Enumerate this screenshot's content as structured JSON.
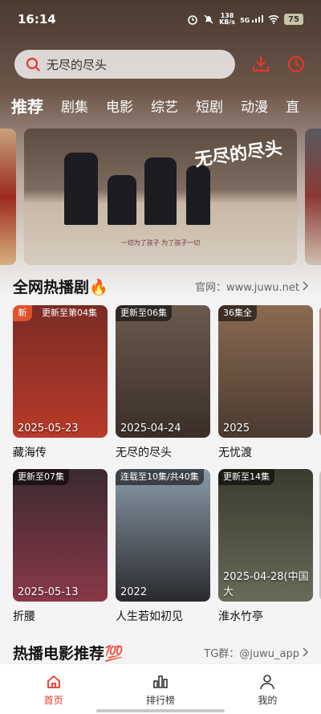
{
  "status_bar": {
    "time": "16:14",
    "net_speed_value": "138",
    "net_speed_unit": "KB/s",
    "signal_label": "5G",
    "battery": "75"
  },
  "search": {
    "value": "无尽的尽头"
  },
  "tabs": [
    {
      "label": "推荐",
      "active": true
    },
    {
      "label": "剧集"
    },
    {
      "label": "电影"
    },
    {
      "label": "综艺"
    },
    {
      "label": "短剧"
    },
    {
      "label": "动漫"
    },
    {
      "label": "直"
    }
  ],
  "banner": {
    "title": "无尽的尽头",
    "tagline": "一切为了孩子  为了孩子一切"
  },
  "hot_section": {
    "title": "全网热播剧",
    "emoji": "🔥",
    "link_text": "官网：www.juwu.net"
  },
  "hot_row1": [
    {
      "badge_new": "新",
      "badge": "更新至第04集",
      "date": "2025-05-23",
      "title": "藏海传",
      "color_top": "#7a2c24",
      "color_bottom": "#b83a2a"
    },
    {
      "badge": "更新至06集",
      "date": "2025-04-24",
      "title": "无尽的尽头",
      "color_top": "#6a5a4e",
      "color_bottom": "#3a2e28"
    },
    {
      "badge": "36集全",
      "date": "2025",
      "title": "无忧渡",
      "color_top": "#8a6a52",
      "color_bottom": "#4a3a30"
    }
  ],
  "hot_row2": [
    {
      "badge": "更新至07集",
      "date": "2025-05-13",
      "title": "折腰",
      "color_top": "#3a2a30",
      "color_bottom": "#8a3848"
    },
    {
      "badge": "连载至10集/共40集",
      "date": "2022",
      "title": "人生若如初见",
      "color_top": "#8a9aa8",
      "color_bottom": "#2a2a2e"
    },
    {
      "badge": "更新至14集",
      "date": "2025-04-28(中国大",
      "title": "淮水竹亭",
      "color_top": "#3a3a2e",
      "color_bottom": "#6a6a58"
    }
  ],
  "movie_section": {
    "title": "热播电影推荐",
    "emoji": "💯",
    "link_text": "TG群：@juwu_app"
  },
  "bottom_nav": [
    {
      "label": "首页",
      "icon": "home-icon",
      "active": true
    },
    {
      "label": "排行榜",
      "icon": "chart-icon"
    },
    {
      "label": "我的",
      "icon": "user-icon"
    }
  ],
  "colors": {
    "accent": "#e8352d",
    "tab_text": "#ffffff",
    "background": "#f4f4f4"
  }
}
